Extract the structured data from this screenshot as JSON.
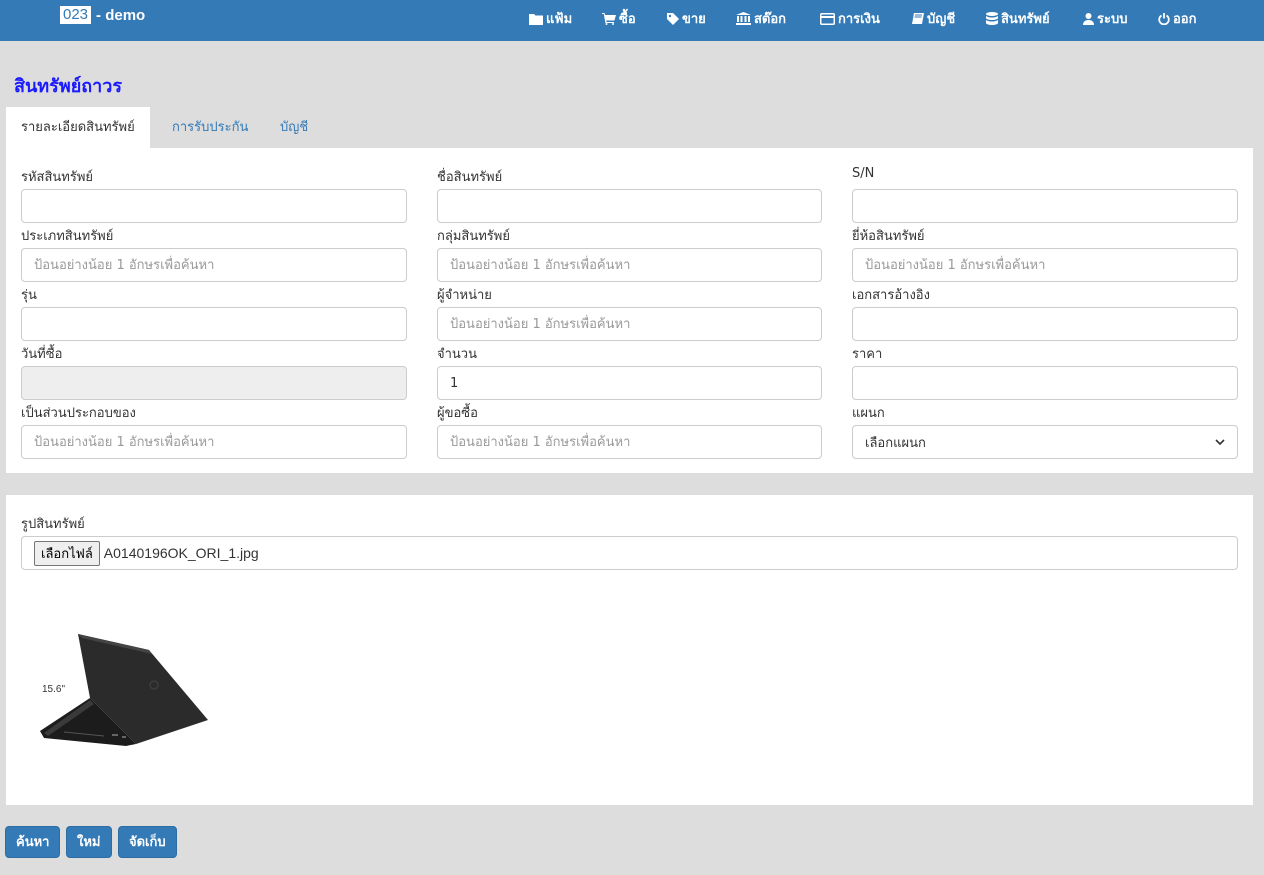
{
  "header": {
    "code": "023",
    "title": "- demo",
    "nav": [
      {
        "label": "แฟ้ม",
        "icon": "folder-icon"
      },
      {
        "label": "ซื้อ",
        "icon": "cart-icon"
      },
      {
        "label": "ขาย",
        "icon": "tag-icon"
      },
      {
        "label": "สต๊อก",
        "icon": "bank-icon"
      },
      {
        "label": "การเงิน",
        "icon": "credit-card-icon"
      },
      {
        "label": "บัญชี",
        "icon": "book-icon"
      },
      {
        "label": "สินทรัพย์",
        "icon": "database-icon"
      },
      {
        "label": "ระบบ",
        "icon": "user-icon"
      },
      {
        "label": "ออก",
        "icon": "power-icon"
      }
    ]
  },
  "page_title": "สินทรัพย์ถาวร",
  "tabs": [
    {
      "label": "รายละเอียดสินทรัพย์",
      "active": true
    },
    {
      "label": "การรับประกัน",
      "active": false
    },
    {
      "label": "บัญชี",
      "active": false
    }
  ],
  "form": {
    "asset_code": {
      "label": "รหัสสินทรัพย์",
      "value": ""
    },
    "asset_name": {
      "label": "ชื่อสินทรัพย์",
      "value": ""
    },
    "serial": {
      "label": "S/N",
      "value": ""
    },
    "asset_type": {
      "label": "ประเภทสินทรัพย์",
      "placeholder": "ป้อนอย่างน้อย 1 อักษรเพื่อค้นหา"
    },
    "asset_group": {
      "label": "กลุ่มสินทรัพย์",
      "placeholder": "ป้อนอย่างน้อย 1 อักษรเพื่อค้นหา"
    },
    "brand": {
      "label": "ยี่ห้อสินทรัพย์",
      "placeholder": "ป้อนอย่างน้อย 1 อักษรเพื่อค้นหา"
    },
    "model": {
      "label": "รุ่น",
      "value": ""
    },
    "vendor": {
      "label": "ผู้จำหน่าย",
      "placeholder": "ป้อนอย่างน้อย 1 อักษรเพื่อค้นหา"
    },
    "reference": {
      "label": "เอกสารอ้างอิง",
      "value": ""
    },
    "purchase_date": {
      "label": "วันที่ซื้อ",
      "value": ""
    },
    "quantity": {
      "label": "จำนวน",
      "value": "1"
    },
    "price": {
      "label": "ราคา",
      "value": ""
    },
    "part_of": {
      "label": "เป็นส่วนประกอบของ",
      "placeholder": "ป้อนอย่างน้อย 1 อักษรเพื่อค้นหา"
    },
    "requester": {
      "label": "ผู้ขอซื้อ",
      "placeholder": "ป้อนอย่างน้อย 1 อักษรเพื่อค้นหา"
    },
    "department": {
      "label": "แผนก",
      "selected": "เลือกแผนก"
    }
  },
  "image_section": {
    "label": "รูปสินทรัพย์",
    "choose_button": "เลือกไฟล์",
    "file_name": "A0140196OK_ORI_1.jpg",
    "photo_caption": "15.6\""
  },
  "actions": {
    "search": "ค้นหา",
    "new": "ใหม่",
    "save": "จัดเก็บ"
  }
}
